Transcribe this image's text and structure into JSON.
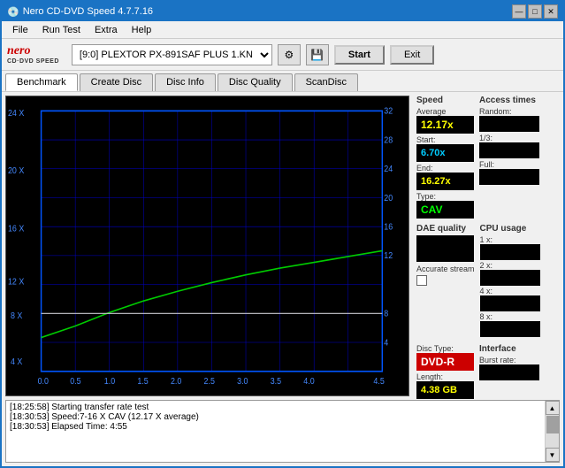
{
  "window": {
    "title": "Nero CD-DVD Speed 4.7.7.16",
    "controls": [
      "—",
      "□",
      "✕"
    ]
  },
  "menu": {
    "items": [
      "File",
      "Run Test",
      "Extra",
      "Help"
    ]
  },
  "toolbar": {
    "logo_top": "nero",
    "logo_bottom": "CD·DVD SPEED",
    "drive_selector": "[9:0]  PLEXTOR PX-891SAF PLUS 1.KN",
    "start_label": "Start",
    "exit_label": "Exit"
  },
  "tabs": [
    "Benchmark",
    "Create Disc",
    "Disc Info",
    "Disc Quality",
    "ScanDisc"
  ],
  "active_tab": "Benchmark",
  "chart": {
    "y_left_labels": [
      "24 X",
      "20 X",
      "16 X",
      "12 X",
      "8 X",
      "4 X"
    ],
    "y_right_labels": [
      "32",
      "28",
      "24",
      "20",
      "16",
      "12",
      "8",
      "4"
    ],
    "x_labels": [
      "0.0",
      "0.5",
      "1.0",
      "1.5",
      "2.0",
      "2.5",
      "3.0",
      "3.5",
      "4.0",
      "4.5"
    ]
  },
  "speed_panel": {
    "title": "Speed",
    "average_label": "Average",
    "average_value": "12.17x",
    "start_label": "Start:",
    "start_value": "6.70x",
    "end_label": "End:",
    "end_value": "16.27x",
    "type_label": "Type:",
    "type_value": "CAV"
  },
  "access_panel": {
    "title": "Access times",
    "random_label": "Random:",
    "random_value": "",
    "onethird_label": "1/3:",
    "onethird_value": "",
    "full_label": "Full:",
    "full_value": ""
  },
  "cpu_panel": {
    "title": "CPU usage",
    "one_x_label": "1 x:",
    "one_x_value": "",
    "two_x_label": "2 x:",
    "two_x_value": "",
    "four_x_label": "4 x:",
    "four_x_value": "",
    "eight_x_label": "8 x:",
    "eight_x_value": ""
  },
  "dae_panel": {
    "title": "DAE quality",
    "value": "",
    "accurate_stream_label": "Accurate stream",
    "checked": false
  },
  "disc_panel": {
    "type_label": "Disc Type:",
    "type_value": "DVD-R",
    "length_label": "Length:",
    "length_value": "4.38 GB"
  },
  "interface_panel": {
    "title": "Interface",
    "burst_rate_label": "Burst rate:",
    "burst_rate_value": ""
  },
  "log": {
    "entries": [
      "[18:25:58]  Starting transfer rate test",
      "[18:30:53]  Speed:7-16 X CAV (12.17 X average)",
      "[18:30:53]  Elapsed Time: 4:55"
    ]
  }
}
